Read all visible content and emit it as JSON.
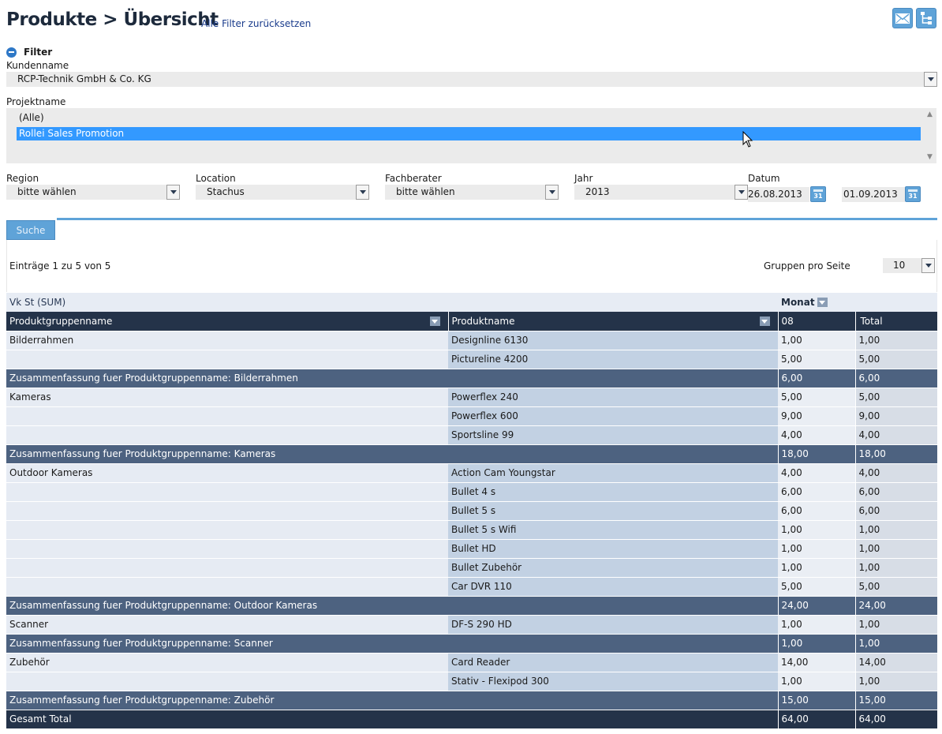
{
  "header": {
    "title": "Produkte > Übersicht",
    "reset_link": "Alle Filter zurücksetzen"
  },
  "filter": {
    "heading": "Filter",
    "customer": {
      "label": "Kundenname",
      "value": "RCP-Technik GmbH & Co. KG"
    },
    "project": {
      "label": "Projektname",
      "options": [
        "(Alle)",
        "Rollei Sales Promotion"
      ],
      "selected": "Rollei Sales Promotion"
    },
    "region": {
      "label": "Region",
      "value": "bitte wählen"
    },
    "location": {
      "label": "Location",
      "value": "Stachus"
    },
    "advisor": {
      "label": "Fachberater",
      "value": "bitte wählen"
    },
    "year": {
      "label": "Jahr",
      "value": "2013"
    },
    "date": {
      "label": "Datum",
      "from": "26.08.2013",
      "to": "01.09.2013",
      "cal_day": "31"
    }
  },
  "search_tab": "Suche",
  "results": {
    "entries_text": "Einträge 1 zu 5 von 5",
    "groups_per_page_label": "Gruppen pro Seite",
    "groups_per_page_value": "10"
  },
  "pivot": {
    "measure_label": "Vk St (SUM)",
    "column_field": "Monat",
    "headers": {
      "group": "Produktgruppenname",
      "product": "Produktname",
      "month": "08",
      "total": "Total"
    },
    "rows": [
      {
        "type": "data",
        "group": "Bilderrahmen",
        "product": "Designline 6130",
        "m08": "1,00",
        "total": "1,00"
      },
      {
        "type": "data",
        "group": "",
        "product": "Pictureline 4200",
        "m08": "5,00",
        "total": "5,00"
      },
      {
        "type": "summary",
        "label": "Zusammenfassung fuer Produktgruppenname: Bilderrahmen",
        "m08": "6,00",
        "total": "6,00"
      },
      {
        "type": "data",
        "group": "Kameras",
        "product": "Powerflex 240",
        "m08": "5,00",
        "total": "5,00"
      },
      {
        "type": "data",
        "group": "",
        "product": "Powerflex 600",
        "m08": "9,00",
        "total": "9,00"
      },
      {
        "type": "data",
        "group": "",
        "product": "Sportsline 99",
        "m08": "4,00",
        "total": "4,00"
      },
      {
        "type": "summary",
        "label": "Zusammenfassung fuer Produktgruppenname: Kameras",
        "m08": "18,00",
        "total": "18,00"
      },
      {
        "type": "data",
        "group": "Outdoor Kameras",
        "product": "Action Cam Youngstar",
        "m08": "4,00",
        "total": "4,00"
      },
      {
        "type": "data",
        "group": "",
        "product": "Bullet 4 s",
        "m08": "6,00",
        "total": "6,00"
      },
      {
        "type": "data",
        "group": "",
        "product": "Bullet 5 s",
        "m08": "6,00",
        "total": "6,00"
      },
      {
        "type": "data",
        "group": "",
        "product": "Bullet 5 s Wifi",
        "m08": "1,00",
        "total": "1,00"
      },
      {
        "type": "data",
        "group": "",
        "product": "Bullet HD",
        "m08": "1,00",
        "total": "1,00"
      },
      {
        "type": "data",
        "group": "",
        "product": "Bullet Zubehör",
        "m08": "1,00",
        "total": "1,00"
      },
      {
        "type": "data",
        "group": "",
        "product": "Car DVR 110",
        "m08": "5,00",
        "total": "5,00"
      },
      {
        "type": "summary",
        "label": "Zusammenfassung fuer Produktgruppenname: Outdoor Kameras",
        "m08": "24,00",
        "total": "24,00"
      },
      {
        "type": "data",
        "group": "Scanner",
        "product": "DF-S 290 HD",
        "m08": "1,00",
        "total": "1,00"
      },
      {
        "type": "summary",
        "label": "Zusammenfassung fuer Produktgruppenname: Scanner",
        "m08": "1,00",
        "total": "1,00"
      },
      {
        "type": "data",
        "group": "Zubehör",
        "product": "Card Reader",
        "m08": "14,00",
        "total": "14,00"
      },
      {
        "type": "data",
        "group": "",
        "product": "Stativ - Flexipod 300",
        "m08": "1,00",
        "total": "1,00"
      },
      {
        "type": "summary",
        "label": "Zusammenfassung fuer Produktgruppenname: Zubehör",
        "m08": "15,00",
        "total": "15,00"
      },
      {
        "type": "total",
        "label": "Gesamt Total",
        "m08": "64,00",
        "total": "64,00"
      }
    ]
  },
  "colors": {
    "header_dark": "#243349",
    "summary": "#4d6280",
    "accent": "#5fa3d8",
    "selection": "#3399ff"
  },
  "icons": [
    "mail-icon",
    "sitemap-icon",
    "calendar-icon",
    "chevron-down-icon",
    "collapse-icon",
    "sort-icon"
  ]
}
